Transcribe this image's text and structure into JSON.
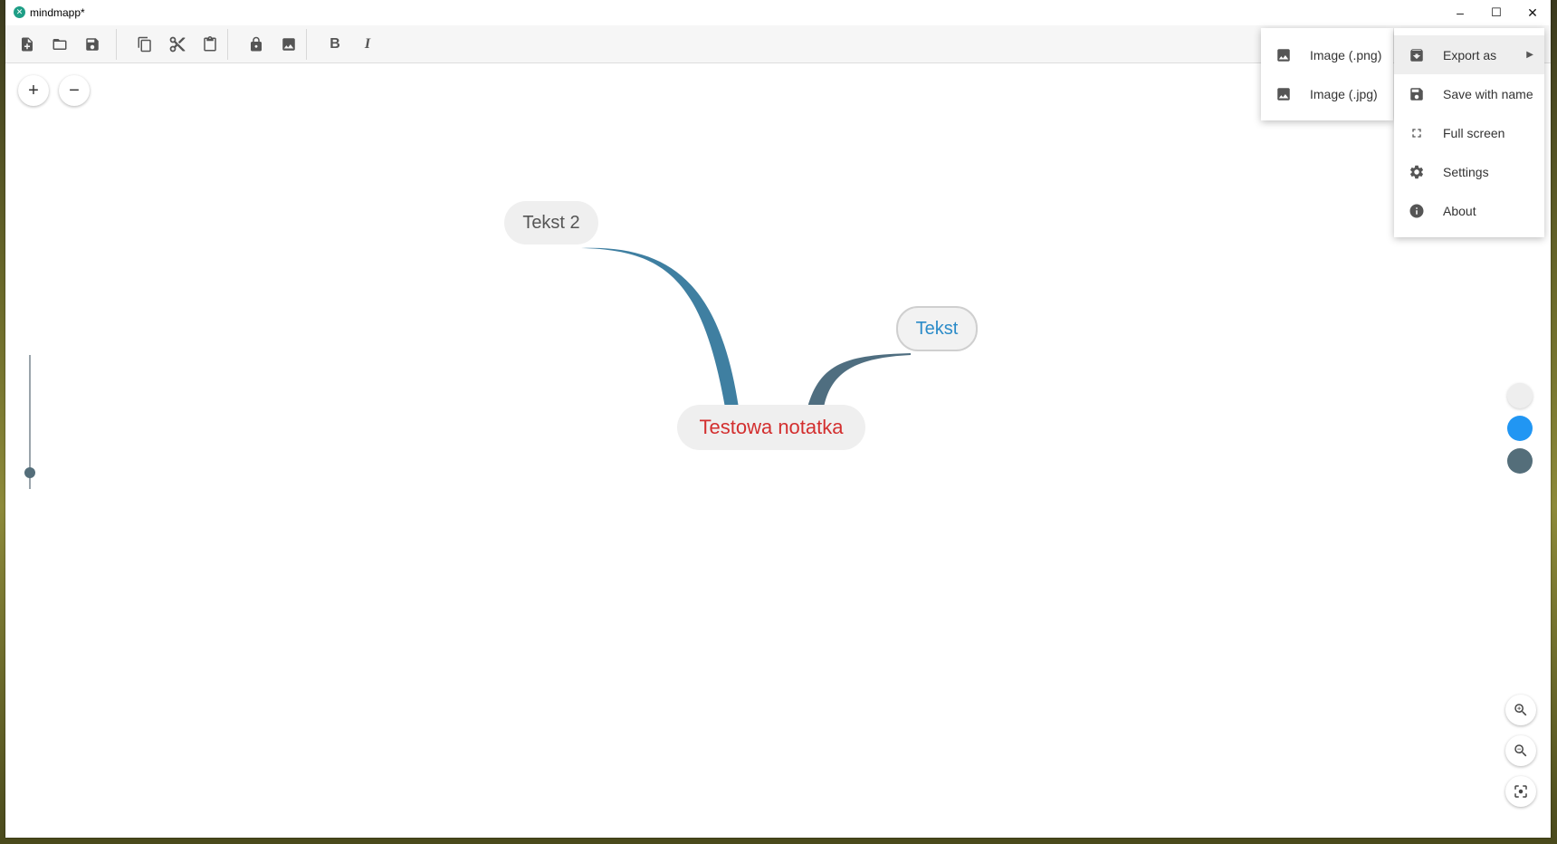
{
  "window": {
    "title": "mindmapp*"
  },
  "win_controls": {
    "minimize": "–",
    "maximize": "☐",
    "close": "✕"
  },
  "toolbar": {
    "icons": [
      "new-file",
      "open-folder",
      "save",
      "copy",
      "cut",
      "paste",
      "lock",
      "image",
      "bold",
      "italic"
    ],
    "bold_label": "B",
    "italic_label": "I"
  },
  "canvas": {
    "add_button": "+",
    "remove_button": "−",
    "nodes": {
      "root": "Testowa notatka",
      "child1": "Tekst 2",
      "child2": "Tekst"
    },
    "colors": {
      "root_text": "#d32f2f",
      "child1_text": "#555555",
      "child2_text": "#2b8bc8",
      "branch1": "#3f7fa1",
      "branch2": "#4f6e80"
    },
    "color_swatches": [
      "#eeeeee",
      "#2196f3",
      "#546e7a"
    ]
  },
  "main_menu": {
    "items": [
      {
        "label": "Export as",
        "icon": "export-icon",
        "has_submenu": true
      },
      {
        "label": "Save with name",
        "icon": "save-icon"
      },
      {
        "label": "Full screen",
        "icon": "fullscreen-icon"
      },
      {
        "label": "Settings",
        "icon": "gear-icon"
      },
      {
        "label": "About",
        "icon": "info-icon"
      }
    ]
  },
  "export_submenu": {
    "items": [
      {
        "label": "Image (.png)",
        "icon": "image-icon"
      },
      {
        "label": "Image (.jpg)",
        "icon": "image-icon"
      }
    ]
  },
  "zoom_controls": [
    "zoom-in-icon",
    "zoom-out-icon",
    "center-focus-icon"
  ]
}
